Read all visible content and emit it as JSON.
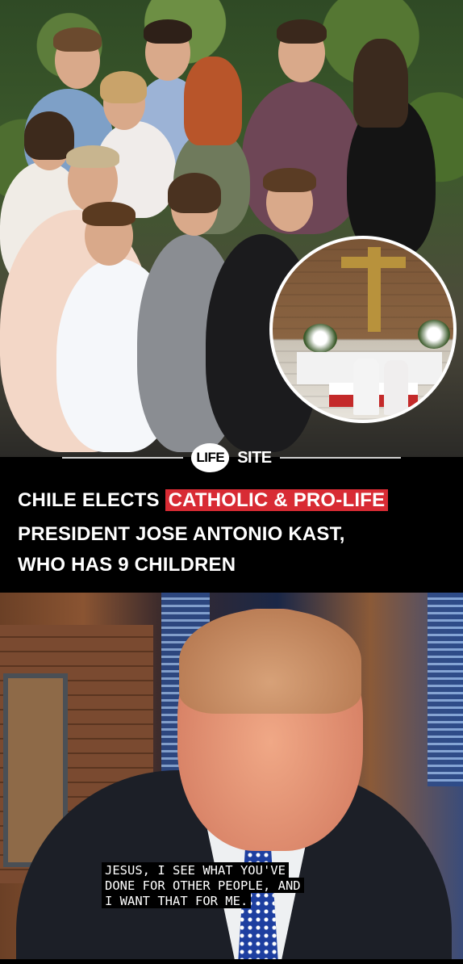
{
  "logo": {
    "life": "LIFE",
    "site": "SITE"
  },
  "headline": {
    "line1_plain": "CHILE ELECTS ",
    "line1_highlight": "CATHOLIC & PRO-LIFE",
    "line2": "PRESIDENT JOSE ANTONIO KAST,",
    "line3": "WHO HAS 9 CHILDREN",
    "accent_color": "#d82b34"
  },
  "caption": {
    "lines": [
      "JESUS, I SEE WHAT YOU'VE",
      "DONE FOR OTHER PEOPLE, AND",
      "I WANT THAT FOR ME."
    ]
  }
}
